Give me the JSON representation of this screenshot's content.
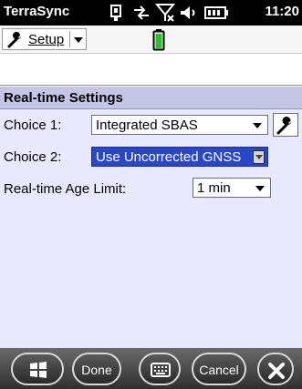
{
  "status_bar": {
    "app_title": "TerraSync",
    "time": "11:20",
    "icons": [
      "phone-signal-icon",
      "connectivity-icon",
      "signal-off-icon",
      "volume-icon",
      "battery-icon"
    ]
  },
  "toolbar": {
    "setup_label": "Setup",
    "setup_icon": "wrench-icon",
    "status_icon": "battery-green-icon"
  },
  "section": {
    "title": "Real-time Settings"
  },
  "choice1": {
    "label": "Choice 1:",
    "value": "Integrated SBAS",
    "button_icon": "wrench-icon"
  },
  "choice2": {
    "label": "Choice 2:",
    "value": "Use Uncorrected GNSS"
  },
  "age_limit": {
    "label": "Real-time Age Limit:",
    "value": "1 min"
  },
  "bottom_bar": {
    "start_icon": "windows-start-icon",
    "done_label": "Done",
    "keyboard_icon": "keyboard-icon",
    "cancel_label": "Cancel",
    "close_icon": "close-icon"
  },
  "colors": {
    "panel_bg": "#e8e8ff",
    "header_bg": "#c5c5e6",
    "selection": "#2a47c8",
    "battery_green": "#29c329"
  }
}
